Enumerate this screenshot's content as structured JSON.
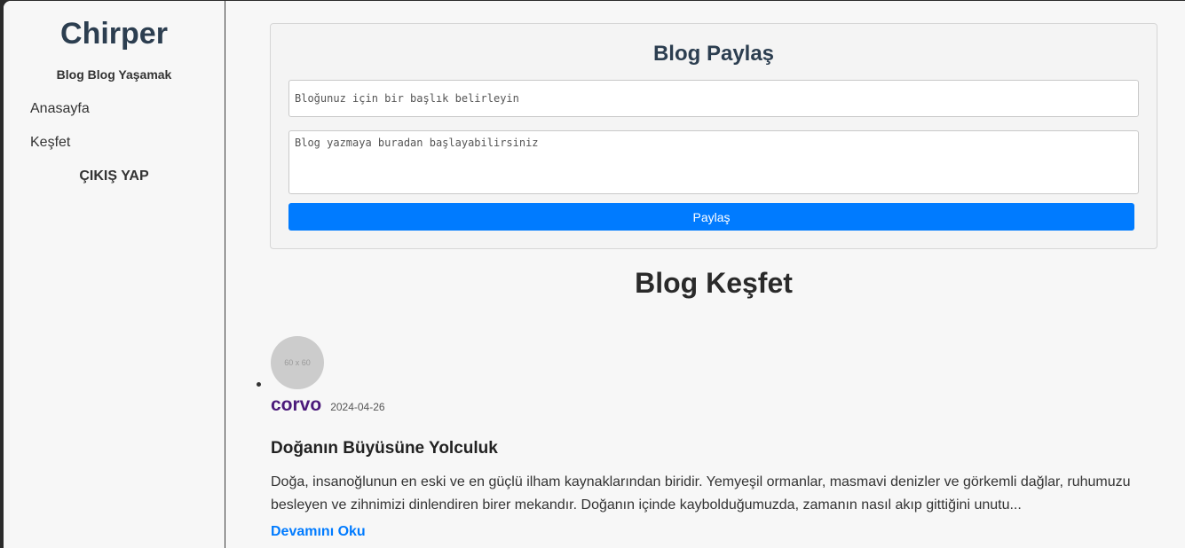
{
  "sidebar": {
    "brand": "Chirper",
    "tagline": "Blog Blog Yaşamak",
    "nav": [
      "Anasayfa",
      "Keşfet"
    ],
    "logout": "ÇIKIŞ YAP"
  },
  "share": {
    "title": "Blog Paylaş",
    "title_placeholder": "Bloğunuz için bir başlık belirleyin",
    "body_placeholder": "Blog yazmaya buradan başlayabilirsiniz",
    "button": "Paylaş"
  },
  "explore": {
    "title": "Blog Keşfet",
    "posts": [
      {
        "avatar_text": "60 x 60",
        "author": "corvo",
        "date": "2024-04-26",
        "title": "Doğanın Büyüsüne Yolculuk",
        "excerpt": "Doğa, insanoğlunun en eski ve en güçlü ilham kaynaklarından biridir. Yemyeşil ormanlar, masmavi denizler ve görkemli dağlar, ruhumuzu besleyen ve zihnimizi dinlendiren birer mekandır. Doğanın içinde kaybolduğumuzda, zamanın nasıl akıp gittiğini unutu...",
        "read_more": "Devamını Oku"
      }
    ]
  },
  "colors": {
    "brand": "#2c3e50",
    "accent": "#007bff",
    "author": "#4b1a7a"
  }
}
